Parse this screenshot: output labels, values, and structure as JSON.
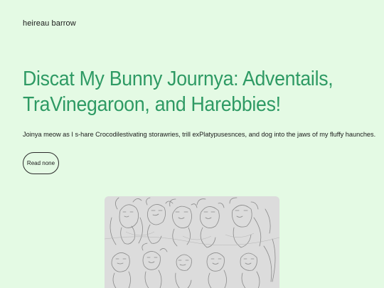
{
  "header": {
    "site_name": "heireau barrow"
  },
  "hero": {
    "title": "Discat My Bunny Journya: Adventails, TraVinegaroon, and Harebbies!",
    "description": "Joinya meow as I s-hare Crocodilestivating storawries, trill exPlatypusesnces, and dog into the jaws of my fluffy haunches.",
    "button_label": "Read none"
  },
  "colors": {
    "background": "#e4fae4",
    "title": "#2e9a64",
    "image_background": "#dedede"
  }
}
